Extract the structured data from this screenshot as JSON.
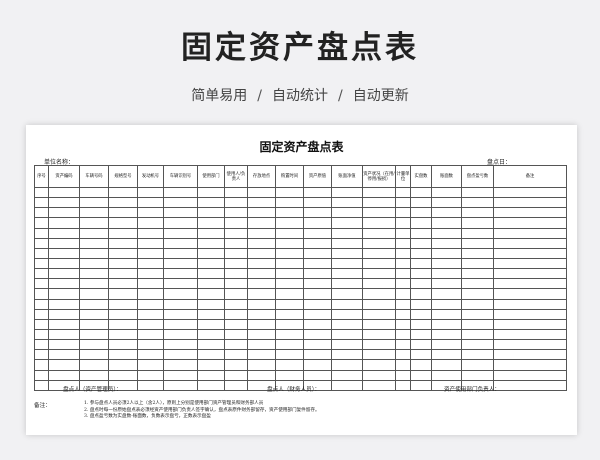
{
  "hero": {
    "title": "固定资产盘点表",
    "features": [
      "简单易用",
      "自动统计",
      "自动更新"
    ],
    "separator": "/"
  },
  "doc": {
    "title": "固定资产盘点表",
    "unit_label": "单位名称：",
    "date_label": "盘点日："
  },
  "table": {
    "headers": [
      "序号",
      "资产编码",
      "车辆号码",
      "规格型号",
      "发动机号",
      "车辆识别号",
      "使用部门",
      "使用人/负责人",
      "存放地点",
      "购置时间",
      "资产原值",
      "账面净值",
      "资产状况（在用/停用/报损）",
      "计量单位",
      "实盘数",
      "账面数",
      "盘点盈亏数",
      "备注"
    ],
    "row_count": 20
  },
  "signatures": {
    "counter": "盘点人（资产管理员）：",
    "counter2": "盘点人（财务人员）：",
    "dept_head": "资产使用部门负责人："
  },
  "notes": {
    "label": "备注：",
    "lines": [
      "1. 参与盘点人员必须2人以上（含2人），原则上分别是使用部门资产管理员和财务部人员",
      "2. 盘点时每一份原始盘点表必须经资产使用部门负责人签字确认，盘点表原件财务部留存，资产使用部门复件留存。",
      "3. 盘点盈亏数为实盘数-账面数，负数表示盘亏，正数表示盘盈"
    ]
  }
}
